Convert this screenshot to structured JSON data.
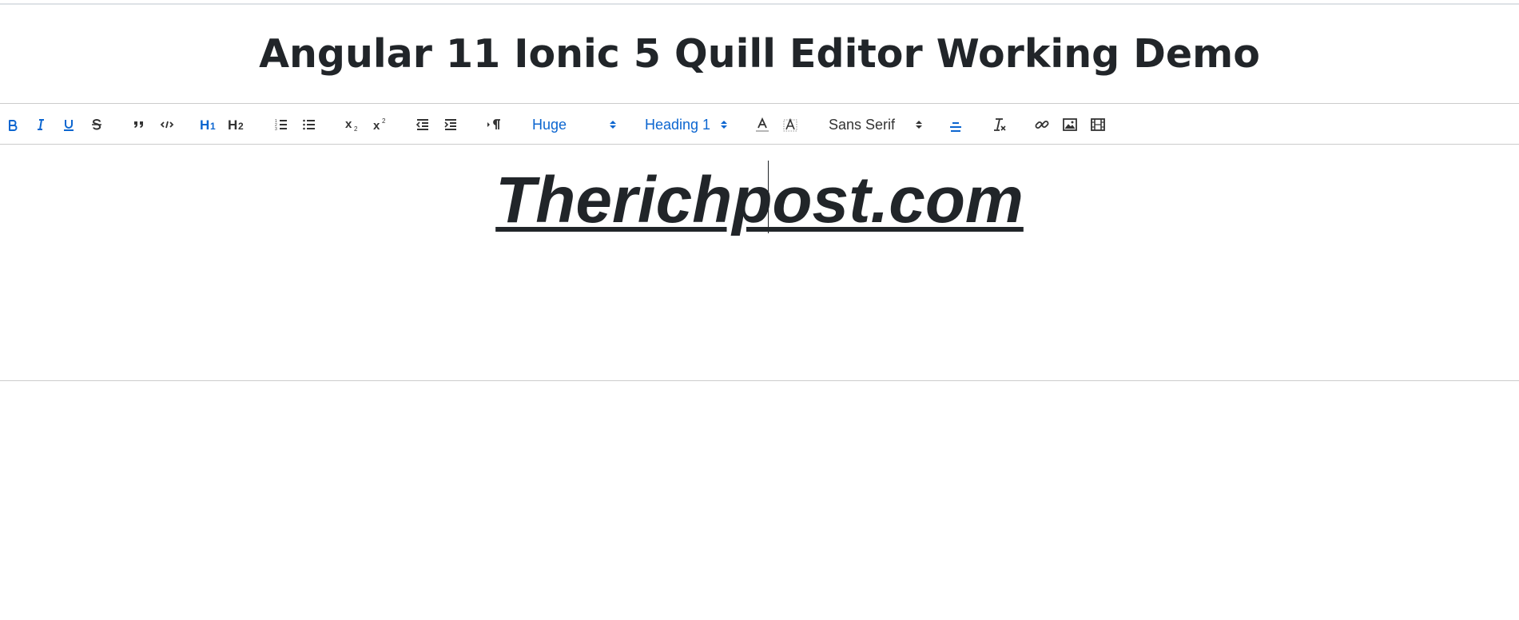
{
  "page": {
    "title": "Angular 11 Ionic 5 Quill Editor Working Demo"
  },
  "toolbar": {
    "buttons": [
      {
        "name": "bold",
        "icon": "bold-icon",
        "active": true
      },
      {
        "name": "italic",
        "icon": "italic-icon",
        "active": true
      },
      {
        "name": "underline",
        "icon": "underline-icon",
        "active": true
      },
      {
        "name": "strike",
        "icon": "strike-icon",
        "active": false
      },
      {
        "name": "blockquote",
        "icon": "blockquote-icon",
        "active": false
      },
      {
        "name": "code-block",
        "icon": "code-block-icon",
        "active": false
      },
      {
        "name": "header-1",
        "icon": "header-1-icon",
        "active": true
      },
      {
        "name": "header-2",
        "icon": "header-2-icon",
        "active": false
      },
      {
        "name": "ordered-list",
        "icon": "ordered-list-icon",
        "active": false
      },
      {
        "name": "bullet-list",
        "icon": "bullet-list-icon",
        "active": false
      },
      {
        "name": "subscript",
        "icon": "subscript-icon",
        "active": false
      },
      {
        "name": "superscript",
        "icon": "superscript-icon",
        "active": false
      },
      {
        "name": "outdent",
        "icon": "outdent-icon",
        "active": false
      },
      {
        "name": "indent",
        "icon": "indent-icon",
        "active": false
      },
      {
        "name": "text-direction",
        "icon": "rtl-icon",
        "active": false
      },
      {
        "name": "text-color",
        "icon": "text-color-icon",
        "active": false
      },
      {
        "name": "background-color",
        "icon": "background-color-icon",
        "active": false
      },
      {
        "name": "align",
        "icon": "align-center-icon",
        "active": true
      },
      {
        "name": "clean",
        "icon": "clear-format-icon",
        "active": false
      },
      {
        "name": "link",
        "icon": "link-icon",
        "active": false
      },
      {
        "name": "image",
        "icon": "image-icon",
        "active": false
      },
      {
        "name": "video",
        "icon": "video-icon",
        "active": false
      }
    ],
    "size_picker": {
      "value": "Huge",
      "active": true
    },
    "header_picker": {
      "value": "Heading 1",
      "active": true
    },
    "font_picker": {
      "value": "Sans Serif",
      "active": false
    }
  },
  "editor": {
    "content": "Therichpost.com"
  },
  "colors": {
    "active": "#0c66d0",
    "inactive": "#333333",
    "text": "#212529",
    "border": "#cccccc"
  }
}
